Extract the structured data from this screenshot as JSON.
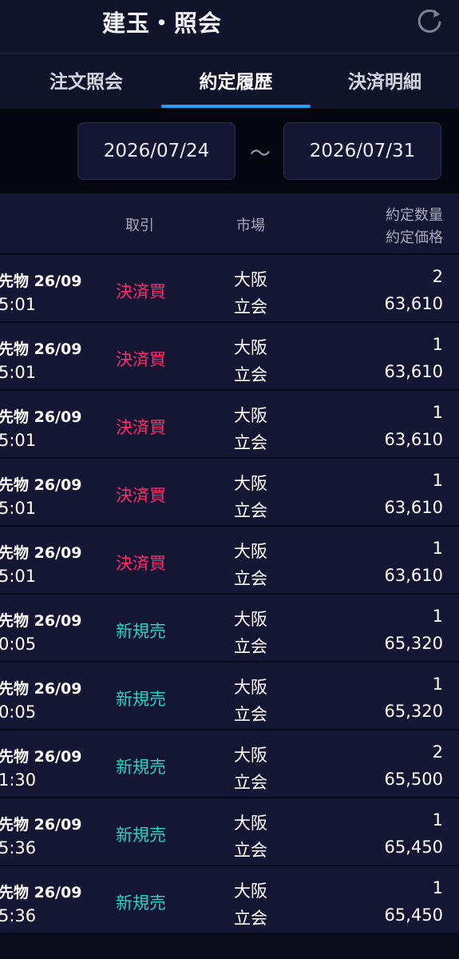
{
  "header": {
    "title": "建玉・照会",
    "refresh_icon": "refresh-icon"
  },
  "tabs": [
    {
      "label": "注文照会",
      "active": false
    },
    {
      "label": "約定履歴",
      "active": true
    },
    {
      "label": "決済明細",
      "active": false
    }
  ],
  "date_range": {
    "from": "2026/07/24",
    "separator": "～",
    "to": "2026/07/31"
  },
  "columns": {
    "trade": "取引",
    "market": "市場",
    "qty": "約定数量",
    "price": "約定価格"
  },
  "colors": {
    "buy": "#ff2d6b",
    "sell": "#27d1c4",
    "accent": "#2a9df0"
  },
  "rows": [
    {
      "symbol": "先物 26/09",
      "time": "5:01",
      "trade": "決済買",
      "type": "buy",
      "market": "大阪",
      "session": "立会",
      "qty": "2",
      "price": "63,610"
    },
    {
      "symbol": "先物 26/09",
      "time": "5:01",
      "trade": "決済買",
      "type": "buy",
      "market": "大阪",
      "session": "立会",
      "qty": "1",
      "price": "63,610"
    },
    {
      "symbol": "先物 26/09",
      "time": "5:01",
      "trade": "決済買",
      "type": "buy",
      "market": "大阪",
      "session": "立会",
      "qty": "1",
      "price": "63,610"
    },
    {
      "symbol": "先物 26/09",
      "time": "5:01",
      "trade": "決済買",
      "type": "buy",
      "market": "大阪",
      "session": "立会",
      "qty": "1",
      "price": "63,610"
    },
    {
      "symbol": "先物 26/09",
      "time": "5:01",
      "trade": "決済買",
      "type": "buy",
      "market": "大阪",
      "session": "立会",
      "qty": "1",
      "price": "63,610"
    },
    {
      "symbol": "先物 26/09",
      "time": "0:05",
      "trade": "新規売",
      "type": "sell",
      "market": "大阪",
      "session": "立会",
      "qty": "1",
      "price": "65,320"
    },
    {
      "symbol": "先物 26/09",
      "time": "0:05",
      "trade": "新規売",
      "type": "sell",
      "market": "大阪",
      "session": "立会",
      "qty": "1",
      "price": "65,320"
    },
    {
      "symbol": "先物 26/09",
      "time": "1:30",
      "trade": "新規売",
      "type": "sell",
      "market": "大阪",
      "session": "立会",
      "qty": "2",
      "price": "65,500"
    },
    {
      "symbol": "先物 26/09",
      "time": "5:36",
      "trade": "新規売",
      "type": "sell",
      "market": "大阪",
      "session": "立会",
      "qty": "1",
      "price": "65,450"
    },
    {
      "symbol": "先物 26/09",
      "time": "5:36",
      "trade": "新規売",
      "type": "sell",
      "market": "大阪",
      "session": "立会",
      "qty": "1",
      "price": "65,450"
    }
  ]
}
